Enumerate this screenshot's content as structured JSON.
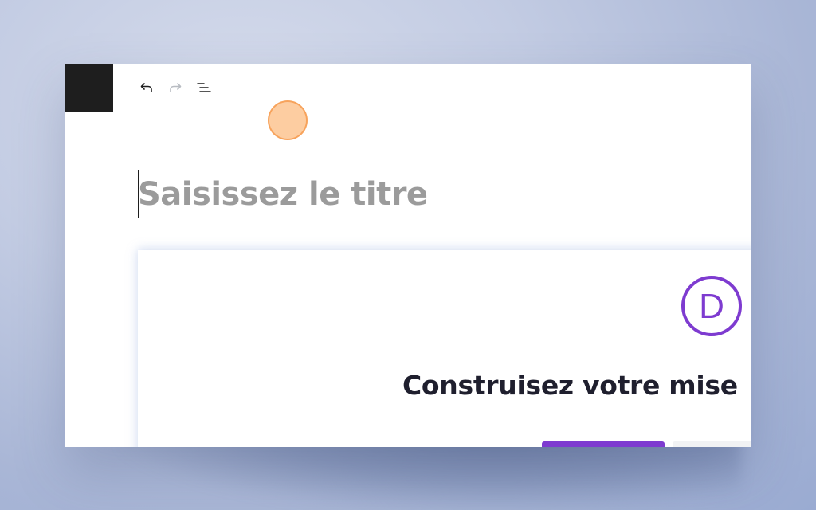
{
  "editor": {
    "title_placeholder": "Saisissez le titre",
    "title_value": ""
  },
  "toolbar": {
    "buttons": [
      {
        "name": "undo",
        "icon": "undo-icon",
        "enabled": true
      },
      {
        "name": "redo",
        "icon": "redo-icon",
        "enabled": false
      },
      {
        "name": "list-view",
        "icon": "list-view-icon",
        "enabled": true
      }
    ]
  },
  "divi": {
    "logo_letter": "D",
    "heading": "Construisez votre mise",
    "primary_button_label": "",
    "secondary_button_label": ""
  },
  "colors": {
    "accent": "#7e3bd0",
    "toolbar_logo_bg": "#1e1e1e",
    "placeholder_text": "#9b9b9b",
    "click_marker": "#fcb26e"
  }
}
